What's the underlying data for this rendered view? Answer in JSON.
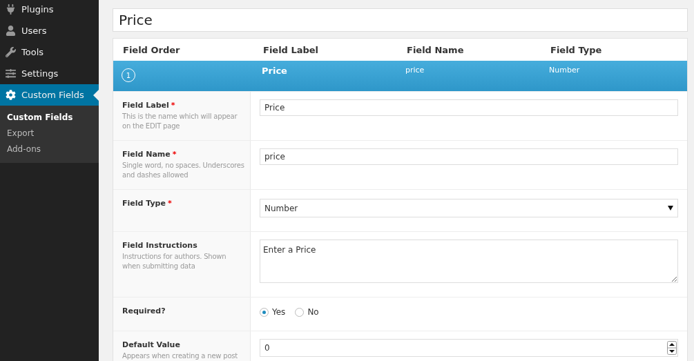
{
  "sidebar": {
    "items": [
      {
        "label": "Plugins",
        "selected": false
      },
      {
        "label": "Users",
        "selected": false
      },
      {
        "label": "Tools",
        "selected": false
      },
      {
        "label": "Settings",
        "selected": false
      },
      {
        "label": "Custom Fields",
        "selected": true
      }
    ],
    "submenu": [
      {
        "label": "Custom Fields",
        "selected": true
      },
      {
        "label": "Export",
        "selected": false
      },
      {
        "label": "Add-ons",
        "selected": false
      }
    ]
  },
  "title": {
    "value": "Price"
  },
  "table": {
    "columns": [
      "Field Order",
      "Field Label",
      "Field Name",
      "Field Type"
    ],
    "row": {
      "order": "1",
      "label": "Price",
      "name": "price",
      "type": "Number",
      "selected": true
    }
  },
  "form": [
    {
      "kind": "text",
      "label": "Field Label",
      "required_mark": "*",
      "hint": "This is the name which will appear on the EDIT page",
      "value": "Price"
    },
    {
      "kind": "text",
      "label": "Field Name",
      "required_mark": "*",
      "hint": "Single word, no spaces. Underscores and dashes allowed",
      "value": "price"
    },
    {
      "kind": "select",
      "label": "Field Type",
      "required_mark": "*",
      "value": "Number"
    },
    {
      "kind": "textarea",
      "label": "Field Instructions",
      "hint": "Instructions for authors. Shown when submitting data",
      "value": "Enter a Price"
    },
    {
      "kind": "radio",
      "label": "Required?",
      "options": [
        {
          "label": "Yes",
          "selected": true
        },
        {
          "label": "No",
          "selected": false
        }
      ]
    },
    {
      "kind": "number",
      "label": "Default Value",
      "hint": "Appears when creating a new post",
      "value": "0"
    }
  ]
}
